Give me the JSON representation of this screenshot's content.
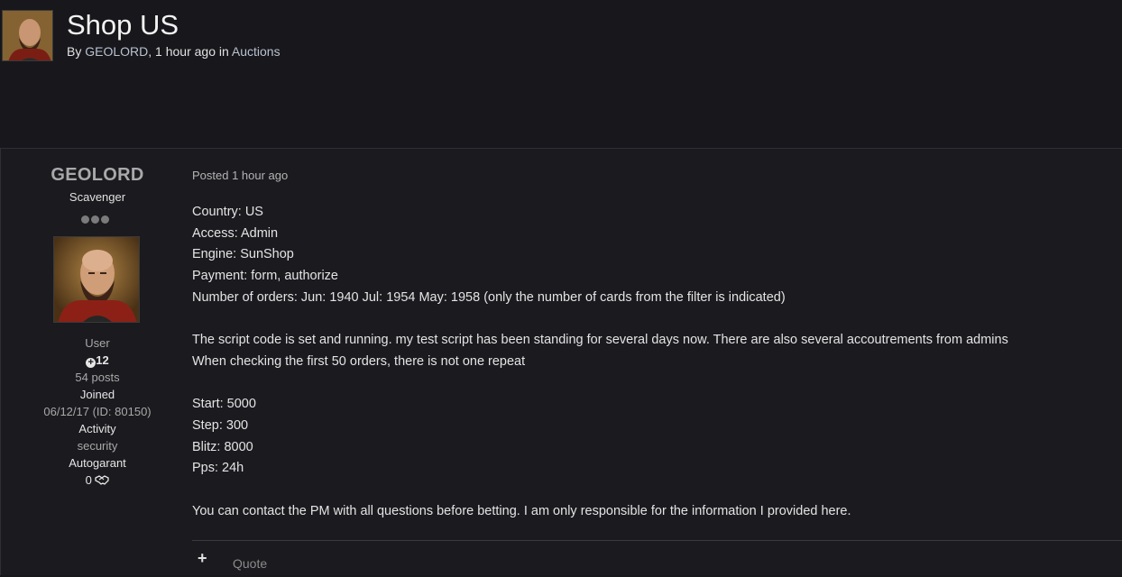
{
  "topic": {
    "title": "Shop US",
    "by_prefix": "By ",
    "author": "GEOLORD",
    "time_in": ", 1 hour ago in ",
    "forum": "Auctions"
  },
  "author": {
    "name": "GEOLORD",
    "title": "Scavenger",
    "group": "User",
    "reputation": "12",
    "posts": "54 posts",
    "joined_label": "Joined",
    "joined_value": "06/12/17 (ID: 80150)",
    "activity_label": "Activity",
    "activity_value": "security",
    "autogarant_label": "Autogarant",
    "autogarant_value": "0"
  },
  "post": {
    "posted": "Posted 1 hour ago",
    "lines": [
      "Country: US",
      "Access: Admin",
      "Engine: SunShop",
      "Payment: form, authorize",
      "Number of orders: Jun: 1940 Jul: 1954 May: 1958 (only the number of cards from the filter is indicated)",
      "",
      "The script code is set and running. my test script has been standing for several days now. There are also several accoutrements from admins",
      "When checking the first 50 orders, there is not one repeat",
      "",
      "Start: 5000",
      "Step: 300",
      "Blitz: 8000",
      "Pps: 24h",
      "",
      "You can contact the PM with all questions before betting. I am only responsible for the information I provided here."
    ]
  },
  "footer": {
    "plus_icon": "+",
    "quote_label": "Quote"
  },
  "icons": {
    "reputation": "plus-circle-icon",
    "autogarant": "handshake-icon"
  }
}
